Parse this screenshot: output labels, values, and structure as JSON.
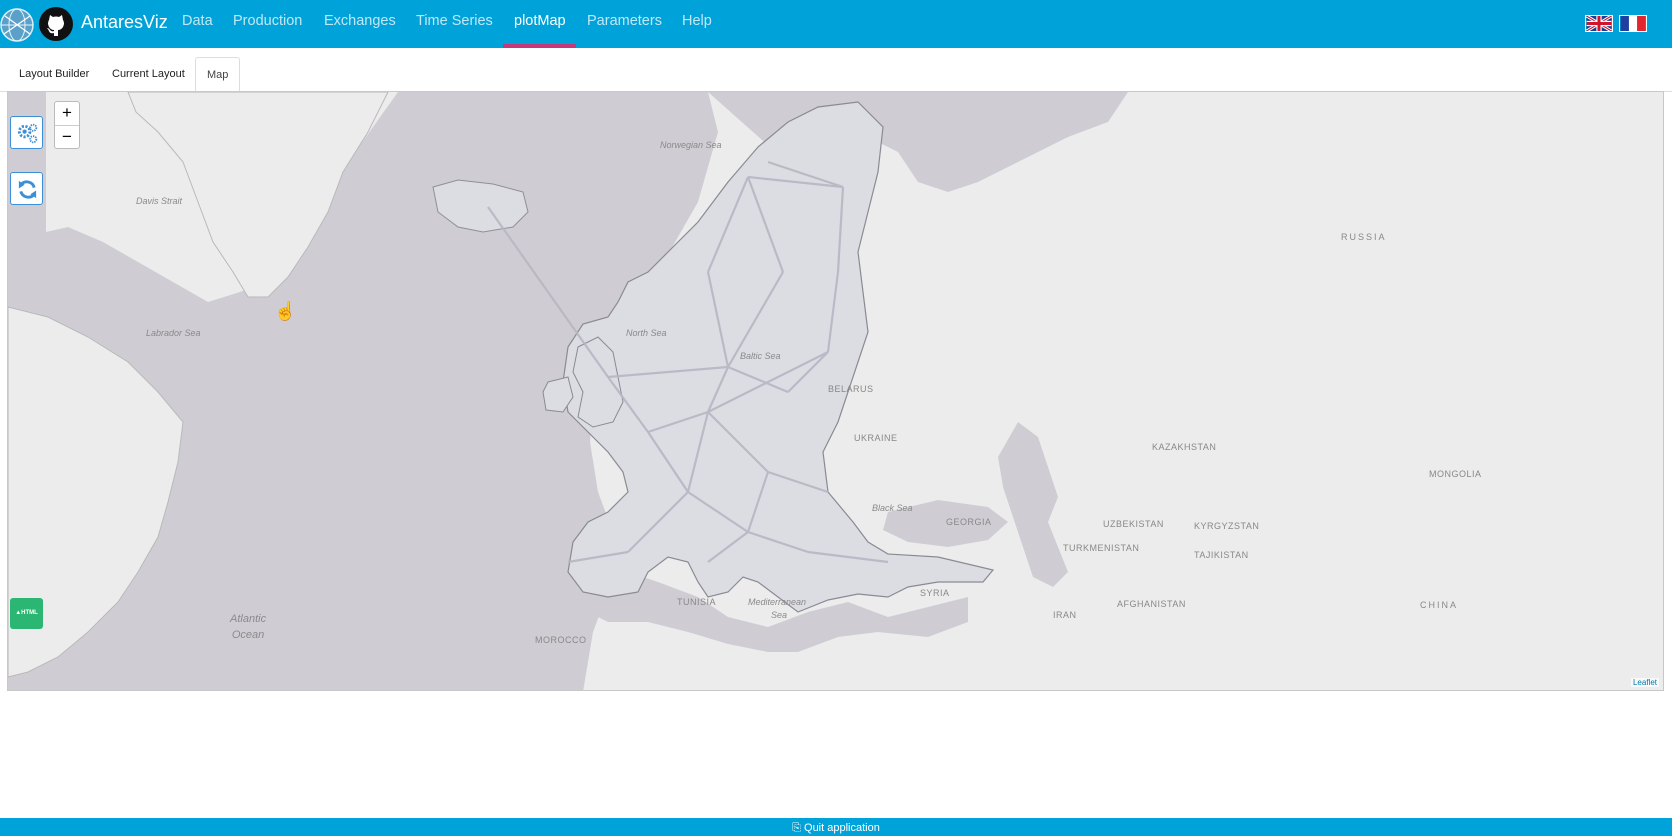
{
  "app": {
    "title": "AntaresViz"
  },
  "nav": {
    "items": [
      {
        "label": "Data"
      },
      {
        "label": "Production"
      },
      {
        "label": "Exchanges"
      },
      {
        "label": "Time Series"
      },
      {
        "label": "plotMap"
      },
      {
        "label": "Parameters"
      },
      {
        "label": "Help"
      }
    ],
    "active": "plotMap",
    "languages": [
      "english-flag-icon",
      "french-flag-icon"
    ]
  },
  "tabs": {
    "items": [
      {
        "label": "Layout Builder"
      },
      {
        "label": "Current Layout"
      },
      {
        "label": "Map"
      }
    ],
    "active": "Map"
  },
  "map": {
    "zoom_in": "+",
    "zoom_out": "−",
    "export_label": "▲HTML",
    "attribution": "Leaflet",
    "country_labels": {
      "russia": "RUSSIA",
      "belarus": "BELARUS",
      "ukraine": "UKRAINE",
      "kazakhstan": "KAZAKHSTAN",
      "mongolia": "MONGOLIA",
      "uzbekistan": "UZBEKISTAN",
      "kyrgyzstan": "KYRGYZSTAN",
      "tajikistan": "TAJIKISTAN",
      "turkmenistan": "TURKMENISTAN",
      "georgia": "GEORGIA",
      "afghanistan": "AFGHANISTAN",
      "iran": "IRAN",
      "china": "CHINA",
      "syria": "SYRIA",
      "tunisia": "TUNISIA",
      "morocco": "MOROCCO"
    },
    "sea_labels": {
      "norwegian_sea": "Norwegian Sea",
      "davis_strait": "Davis Strait",
      "labrador_sea": "Labrador Sea",
      "north_sea": "North Sea",
      "baltic_sea": "Baltic Sea",
      "black_sea": "Black Sea",
      "mediterranean_sea_1": "Mediterranean",
      "mediterranean_sea_2": "Sea",
      "atlantic_1": "Atlantic",
      "atlantic_2": "Ocean"
    }
  },
  "footer": {
    "quit_label": "⎘ Quit application"
  },
  "colors": {
    "navbar": "#00a3d9",
    "active_underline": "#c7387a",
    "map_land": "#ececec",
    "map_water": "#cfcdd3",
    "region_fill": "#dcdce3",
    "link_line": "#b7b7c4",
    "export_button": "#2bb673"
  }
}
